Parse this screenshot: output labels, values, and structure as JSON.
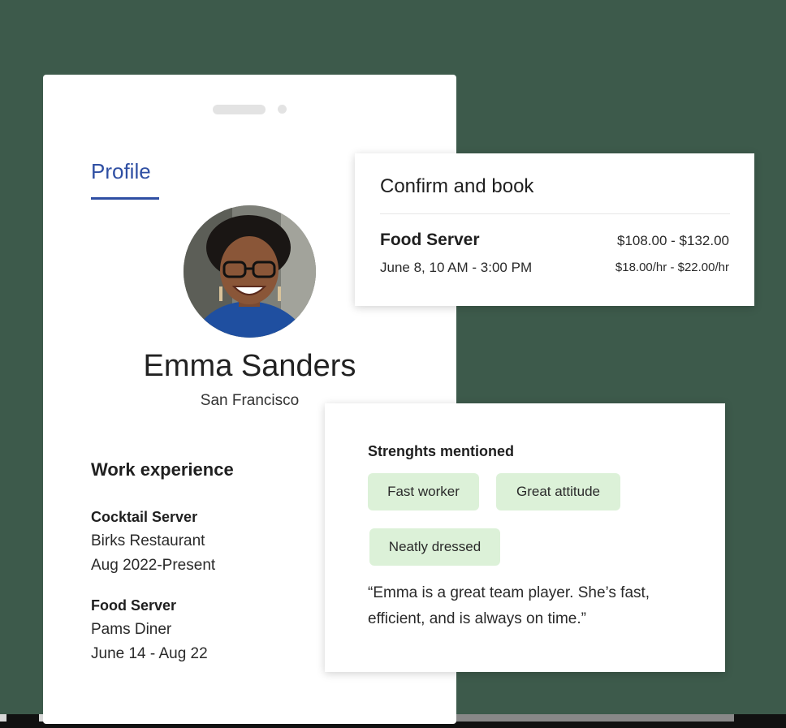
{
  "profile": {
    "tab_label": "Profile",
    "name": "Emma Sanders",
    "city": "San Francisco",
    "work_heading": "Work experience",
    "jobs": [
      {
        "title": "Cocktail Server",
        "employer": "Birks Restaurant",
        "period": "Aug 2022-Present"
      },
      {
        "title": "Food Server",
        "employer": "Pams Diner",
        "period": "June 14 - Aug 22"
      }
    ]
  },
  "confirm": {
    "title": "Confirm and book",
    "role": "Food Server",
    "date": "June 8, 10 AM - 3:00 PM",
    "total": "$108.00 - $132.00",
    "rate": "$18.00/hr - $22.00/hr"
  },
  "strengths": {
    "title": "Strenghts mentioned",
    "chips": [
      "Fast worker",
      "Great attitude",
      "Neatly dressed"
    ],
    "quote": "“Emma is a great team player. She’s fast, efficient, and is always on time.”"
  },
  "colors": {
    "background": "#3d5a4b",
    "accent": "#2f4fa3",
    "chip": "#dcf1d8"
  }
}
